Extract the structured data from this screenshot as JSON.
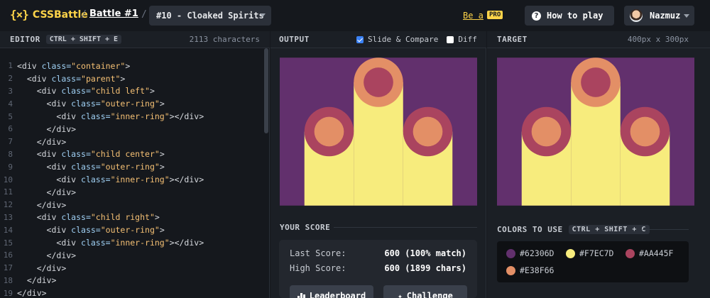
{
  "header": {
    "logo_mark": "{×}",
    "logo_text": "CSSBattle",
    "sep": "/",
    "battle": "Battle #1",
    "target_selected": "#10 - Cloaked Spirits",
    "be_a": "Be a",
    "pro": "PRO",
    "how_to_play": "How to play",
    "user_name": "Nazmuz",
    "icons": {
      "help": "question-circle-icon",
      "dropdown": "chevron-down-icon"
    }
  },
  "editor": {
    "title": "EDITOR",
    "shortcut": "CTRL + SHIFT + E",
    "char_count": "2113 characters",
    "lines": [
      {
        "n": "1",
        "indent": "",
        "tag": "<div ",
        "attr": "class=",
        "str": "\"container\"",
        "end": ">"
      },
      {
        "n": "2",
        "indent": "  ",
        "tag": "<div ",
        "attr": "class=",
        "str": "\"parent\"",
        "end": ">"
      },
      {
        "n": "3",
        "indent": "    ",
        "tag": "<div ",
        "attr": "class=",
        "str": "\"child left\"",
        "end": ">"
      },
      {
        "n": "4",
        "indent": "      ",
        "tag": "<div ",
        "attr": "class=",
        "str": "\"outer-ring\"",
        "end": ">"
      },
      {
        "n": "5",
        "indent": "        ",
        "tag": "<div ",
        "attr": "class=",
        "str": "\"inner-ring\"",
        "end": "></div>"
      },
      {
        "n": "6",
        "indent": "      ",
        "tag": "</div>",
        "attr": "",
        "str": "",
        "end": ""
      },
      {
        "n": "7",
        "indent": "    ",
        "tag": "</div>",
        "attr": "",
        "str": "",
        "end": ""
      },
      {
        "n": "8",
        "indent": "    ",
        "tag": "<div ",
        "attr": "class=",
        "str": "\"child center\"",
        "end": ">"
      },
      {
        "n": "9",
        "indent": "      ",
        "tag": "<div ",
        "attr": "class=",
        "str": "\"outer-ring\"",
        "end": ">"
      },
      {
        "n": "10",
        "indent": "        ",
        "tag": "<div ",
        "attr": "class=",
        "str": "\"inner-ring\"",
        "end": "></div>"
      },
      {
        "n": "11",
        "indent": "      ",
        "tag": "</div>",
        "attr": "",
        "str": "",
        "end": ""
      },
      {
        "n": "12",
        "indent": "    ",
        "tag": "</div>",
        "attr": "",
        "str": "",
        "end": ""
      },
      {
        "n": "13",
        "indent": "    ",
        "tag": "<div ",
        "attr": "class=",
        "str": "\"child right\"",
        "end": ">"
      },
      {
        "n": "14",
        "indent": "      ",
        "tag": "<div ",
        "attr": "class=",
        "str": "\"outer-ring\"",
        "end": ">"
      },
      {
        "n": "15",
        "indent": "        ",
        "tag": "<div ",
        "attr": "class=",
        "str": "\"inner-ring\"",
        "end": "></div>"
      },
      {
        "n": "16",
        "indent": "      ",
        "tag": "</div>",
        "attr": "",
        "str": "",
        "end": ""
      },
      {
        "n": "17",
        "indent": "    ",
        "tag": "</div>",
        "attr": "",
        "str": "",
        "end": ""
      },
      {
        "n": "18",
        "indent": "  ",
        "tag": "</div>",
        "attr": "",
        "str": "",
        "end": ""
      },
      {
        "n": "19",
        "indent": "",
        "tag": "</div>",
        "attr": "",
        "str": "",
        "end": ""
      }
    ]
  },
  "output": {
    "title": "OUTPUT",
    "slide_compare": "Slide & Compare",
    "slide_compare_checked": true,
    "diff": "Diff",
    "diff_checked": false
  },
  "target": {
    "title": "TARGET",
    "dimensions": "400px x 300px"
  },
  "score": {
    "title": "YOUR SCORE",
    "last_label": "Last Score:",
    "last_value": "600 (100% match)",
    "high_label": "High Score:",
    "high_value": "600 (1899 chars)",
    "leaderboard": "Leaderboard",
    "challenge": "Challenge"
  },
  "colors": {
    "title": "COLORS TO USE",
    "shortcut": "CTRL + SHIFT + C",
    "items": [
      {
        "hex": "#62306D",
        "label": "#62306D"
      },
      {
        "hex": "#F7EC7D",
        "label": "#F7EC7D"
      },
      {
        "hex": "#AA445F",
        "label": "#AA445F"
      },
      {
        "hex": "#E38F66",
        "label": "#E38F66"
      }
    ]
  },
  "theme": {
    "accent": "#FDD349",
    "checkbox": "#3B82F6"
  }
}
